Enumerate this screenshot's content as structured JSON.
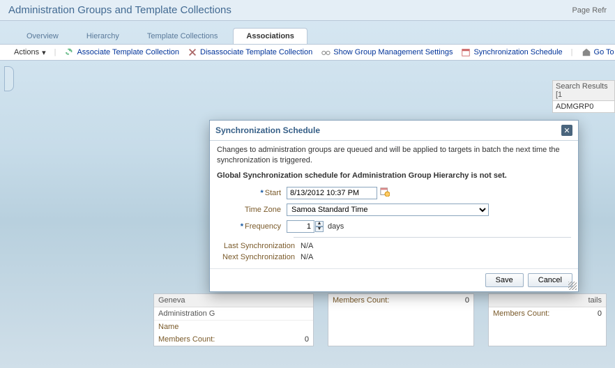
{
  "header": {
    "title": "Administration Groups and Template Collections",
    "right": "Page Refr"
  },
  "tabs": [
    {
      "label": "Overview"
    },
    {
      "label": "Hierarchy"
    },
    {
      "label": "Template Collections"
    },
    {
      "label": "Associations",
      "active": true
    }
  ],
  "toolbar": {
    "actions": "Actions",
    "assoc": "Associate Template Collection",
    "disassoc": "Disassociate Template Collection",
    "show_group": "Show Group Management Settings",
    "sync": "Synchronization Schedule",
    "goto": "Go To G"
  },
  "search": {
    "header": "Search Results [1",
    "item": "ADMGRP0"
  },
  "cards": [
    {
      "title": "Geneva",
      "sub": "Administration G",
      "name_label": "Name",
      "members_label": "Members Count:",
      "members_value": "0",
      "details": ""
    },
    {
      "members_label": "Members Count:",
      "members_value": "0"
    },
    {
      "members_label": "Members Count:",
      "members_value": "0",
      "details": "tails"
    }
  ],
  "modal": {
    "title": "Synchronization Schedule",
    "desc": "Changes to administration groups are queued and will be applied to targets in batch the next time the synchronization is triggered.",
    "status": "Global Synchronization schedule for Administration Group Hierarchy is not set.",
    "start_label": "Start",
    "start_value": "8/13/2012 10:37 PM",
    "tz_label": "Time Zone",
    "tz_value": "Samoa Standard Time",
    "freq_label": "Frequency",
    "freq_value": "1",
    "freq_unit": "days",
    "last_label": "Last Synchronization",
    "last_value": "N/A",
    "next_label": "Next Synchronization",
    "next_value": "N/A",
    "save": "Save",
    "cancel": "Cancel"
  }
}
